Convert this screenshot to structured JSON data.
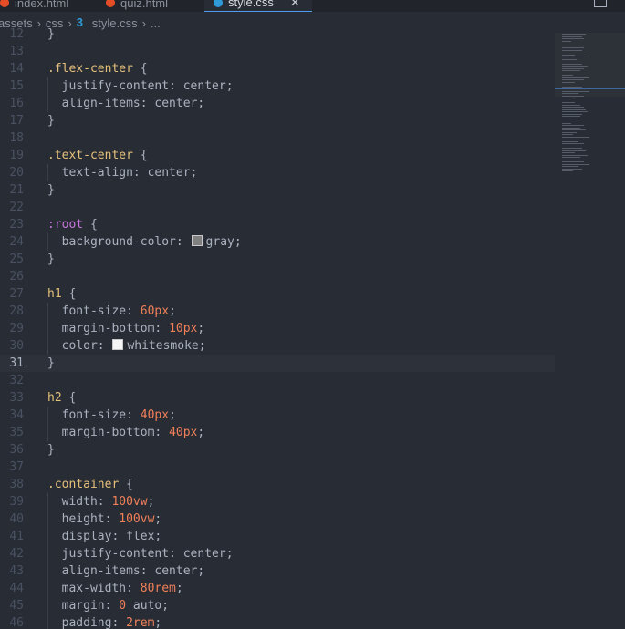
{
  "tabs": [
    {
      "label": "index.html",
      "icon": "html-icon",
      "color": "#e44d26",
      "active": false
    },
    {
      "label": "quiz.html",
      "icon": "html-icon",
      "color": "#e44d26",
      "active": false
    },
    {
      "label": "style.css",
      "icon": "css-icon",
      "color": "#2f9bd8",
      "active": true
    }
  ],
  "breadcrumb": {
    "seg1": "assets",
    "seg2": "css",
    "file": "style.css",
    "ellipsis": "..."
  },
  "current_line": 31,
  "lines": [
    {
      "n": "12",
      "toks": [
        [
          "t-brace",
          "}"
        ]
      ]
    },
    {
      "n": "13",
      "toks": []
    },
    {
      "n": "14",
      "toks": [
        [
          "t-selector",
          ".flex-center"
        ],
        [
          "t-brace",
          " {"
        ]
      ]
    },
    {
      "n": "15",
      "toks": [
        [
          "t-prop",
          "  justify-content"
        ],
        [
          "t-brace",
          ": "
        ],
        [
          "t-value",
          "center"
        ],
        [
          "t-brace",
          ";"
        ]
      ]
    },
    {
      "n": "16",
      "toks": [
        [
          "t-prop",
          "  align-items"
        ],
        [
          "t-brace",
          ": "
        ],
        [
          "t-value",
          "center"
        ],
        [
          "t-brace",
          ";"
        ]
      ]
    },
    {
      "n": "17",
      "toks": [
        [
          "t-brace",
          "}"
        ]
      ]
    },
    {
      "n": "18",
      "toks": []
    },
    {
      "n": "19",
      "toks": [
        [
          "t-selector",
          ".text-center"
        ],
        [
          "t-brace",
          " {"
        ]
      ]
    },
    {
      "n": "20",
      "toks": [
        [
          "t-prop",
          "  text-align"
        ],
        [
          "t-brace",
          ": "
        ],
        [
          "t-value",
          "center"
        ],
        [
          "t-brace",
          ";"
        ]
      ]
    },
    {
      "n": "21",
      "toks": [
        [
          "t-brace",
          "}"
        ]
      ]
    },
    {
      "n": "22",
      "toks": []
    },
    {
      "n": "23",
      "toks": [
        [
          "t-pseudo",
          ":root"
        ],
        [
          "t-brace",
          " {"
        ]
      ]
    },
    {
      "n": "24",
      "toks": [
        [
          "t-prop",
          "  background-color"
        ],
        [
          "t-brace",
          ": "
        ],
        [
          "swatch",
          "#808080"
        ],
        [
          "t-value",
          "gray"
        ],
        [
          "t-brace",
          ";"
        ]
      ]
    },
    {
      "n": "25",
      "toks": [
        [
          "t-brace",
          "}"
        ]
      ]
    },
    {
      "n": "26",
      "toks": []
    },
    {
      "n": "27",
      "toks": [
        [
          "t-selector",
          "h1"
        ],
        [
          "t-brace",
          " {"
        ]
      ]
    },
    {
      "n": "28",
      "toks": [
        [
          "t-prop",
          "  font-size"
        ],
        [
          "t-brace",
          ": "
        ],
        [
          "t-num",
          "60px"
        ],
        [
          "t-brace",
          ";"
        ]
      ]
    },
    {
      "n": "29",
      "toks": [
        [
          "t-prop",
          "  margin-bottom"
        ],
        [
          "t-brace",
          ": "
        ],
        [
          "t-num",
          "10px"
        ],
        [
          "t-brace",
          ";"
        ]
      ]
    },
    {
      "n": "30",
      "toks": [
        [
          "t-prop",
          "  color"
        ],
        [
          "t-brace",
          ": "
        ],
        [
          "swatch",
          "#f5f5f5"
        ],
        [
          "t-value",
          "whitesmoke"
        ],
        [
          "t-brace",
          ";"
        ]
      ]
    },
    {
      "n": "31",
      "toks": [
        [
          "t-brace",
          "}"
        ]
      ]
    },
    {
      "n": "32",
      "toks": []
    },
    {
      "n": "33",
      "toks": [
        [
          "t-selector",
          "h2"
        ],
        [
          "t-brace",
          " {"
        ]
      ]
    },
    {
      "n": "34",
      "toks": [
        [
          "t-prop",
          "  font-size"
        ],
        [
          "t-brace",
          ": "
        ],
        [
          "t-num",
          "40px"
        ],
        [
          "t-brace",
          ";"
        ]
      ]
    },
    {
      "n": "35",
      "toks": [
        [
          "t-prop",
          "  margin-bottom"
        ],
        [
          "t-brace",
          ": "
        ],
        [
          "t-num",
          "40px"
        ],
        [
          "t-brace",
          ";"
        ]
      ]
    },
    {
      "n": "36",
      "toks": [
        [
          "t-brace",
          "}"
        ]
      ]
    },
    {
      "n": "37",
      "toks": []
    },
    {
      "n": "38",
      "toks": [
        [
          "t-selector",
          ".container"
        ],
        [
          "t-brace",
          " {"
        ]
      ]
    },
    {
      "n": "39",
      "toks": [
        [
          "t-prop",
          "  width"
        ],
        [
          "t-brace",
          ": "
        ],
        [
          "t-num",
          "100vw"
        ],
        [
          "t-brace",
          ";"
        ]
      ]
    },
    {
      "n": "40",
      "toks": [
        [
          "t-prop",
          "  height"
        ],
        [
          "t-brace",
          ": "
        ],
        [
          "t-num",
          "100vw"
        ],
        [
          "t-brace",
          ";"
        ]
      ]
    },
    {
      "n": "41",
      "toks": [
        [
          "t-prop",
          "  display"
        ],
        [
          "t-brace",
          ": "
        ],
        [
          "t-value",
          "flex"
        ],
        [
          "t-brace",
          ";"
        ]
      ]
    },
    {
      "n": "42",
      "toks": [
        [
          "t-prop",
          "  justify-content"
        ],
        [
          "t-brace",
          ": "
        ],
        [
          "t-value",
          "center"
        ],
        [
          "t-brace",
          ";"
        ]
      ]
    },
    {
      "n": "43",
      "toks": [
        [
          "t-prop",
          "  align-items"
        ],
        [
          "t-brace",
          ": "
        ],
        [
          "t-value",
          "center"
        ],
        [
          "t-brace",
          ";"
        ]
      ]
    },
    {
      "n": "44",
      "toks": [
        [
          "t-prop",
          "  max-width"
        ],
        [
          "t-brace",
          ": "
        ],
        [
          "t-num",
          "80rem"
        ],
        [
          "t-brace",
          ";"
        ]
      ]
    },
    {
      "n": "45",
      "toks": [
        [
          "t-prop",
          "  margin"
        ],
        [
          "t-brace",
          ": "
        ],
        [
          "t-num",
          "0"
        ],
        [
          "t-value",
          " auto"
        ],
        [
          "t-brace",
          ";"
        ]
      ]
    },
    {
      "n": "46",
      "toks": [
        [
          "t-prop",
          "  padding"
        ],
        [
          "t-brace",
          ": "
        ],
        [
          "t-num",
          "2rem"
        ],
        [
          "t-brace",
          ";"
        ]
      ]
    }
  ]
}
